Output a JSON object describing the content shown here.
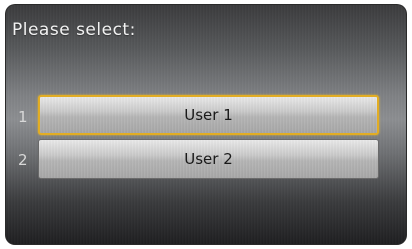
{
  "screen": {
    "title": "Please select:"
  },
  "options": [
    {
      "number": "1",
      "label": "User 1",
      "selected": true
    },
    {
      "number": "2",
      "label": "User 2",
      "selected": false
    }
  ],
  "colors": {
    "selection_outline": "#e2ad24",
    "title_text": "#f2f2f2",
    "button_text": "#1a1a1a"
  }
}
